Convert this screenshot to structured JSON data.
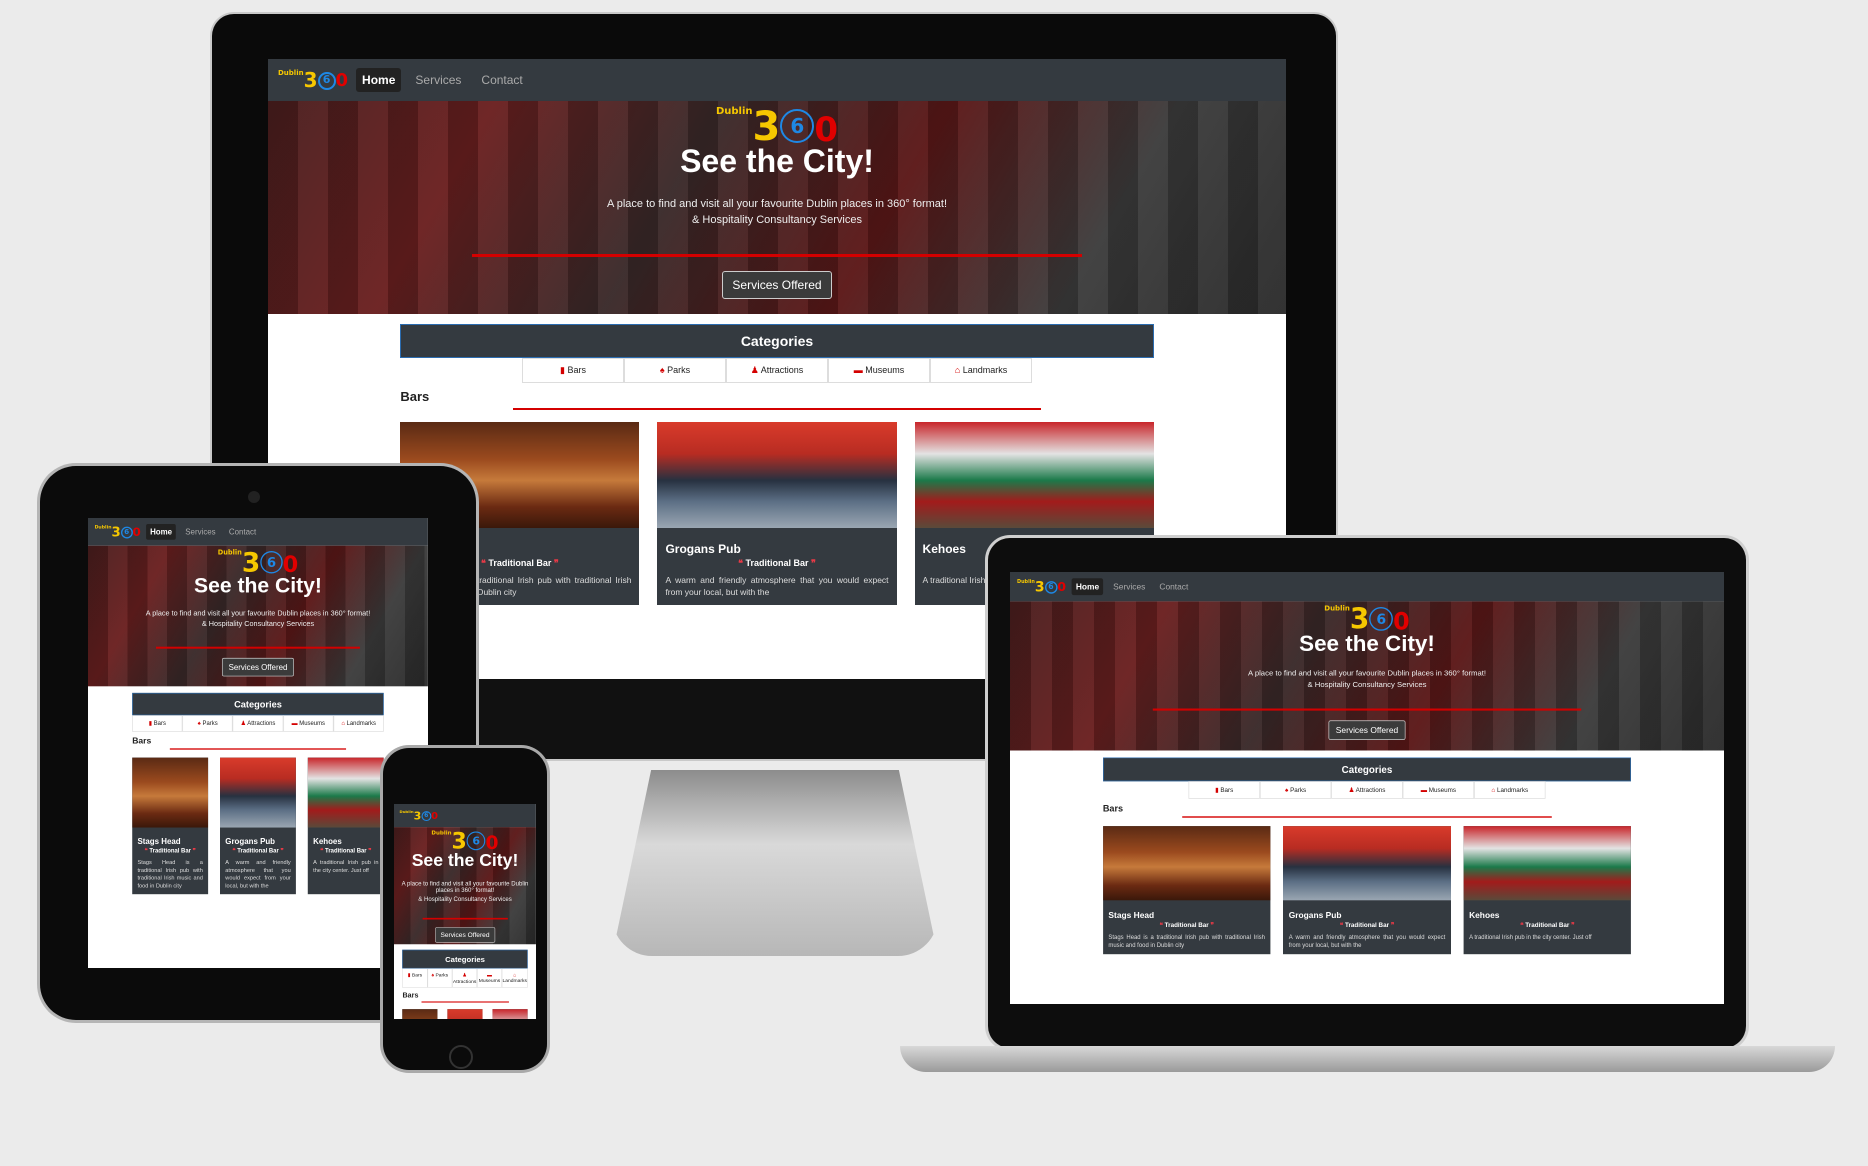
{
  "site": {
    "logo": {
      "small": "Dublin",
      "d3": "3",
      "d6": "6",
      "d0": "0"
    },
    "nav": [
      {
        "label": "Home",
        "active": true
      },
      {
        "label": "Services",
        "active": false
      },
      {
        "label": "Contact",
        "active": false
      }
    ],
    "hero": {
      "title": "See the City!",
      "line1": "A place to find and visit all your favourite Dublin places in 360° format!",
      "line2": "& Hospitality Consultancy Services",
      "button": "Services Offered"
    },
    "categories": {
      "title": "Categories",
      "tabs": [
        {
          "label": "Bars",
          "icon": "beer-icon"
        },
        {
          "label": "Parks",
          "icon": "tree-icon"
        },
        {
          "label": "Attractions",
          "icon": "person-icon"
        },
        {
          "label": "Museums",
          "icon": "ticket-icon"
        },
        {
          "label": "Landmarks",
          "icon": "monument-icon"
        }
      ]
    },
    "section": "Bars",
    "cards": [
      {
        "title": "Stags Head",
        "subtitle": "Traditional Bar",
        "text": "Stags Head is a traditional Irish pub with traditional Irish music and food in Dublin city"
      },
      {
        "title": "Grogans Pub",
        "subtitle": "Traditional Bar",
        "text": "A warm and friendly atmosphere that you would expect from your local, but with the"
      },
      {
        "title": "Kehoes",
        "subtitle": "Traditional Bar",
        "text": "A traditional Irish pub in the city center. Just off"
      }
    ]
  },
  "colors": {
    "brand_red": "#d40000",
    "nav_dark": "#343a40",
    "logo_yellow": "#f6c700",
    "logo_blue": "#1e88e5"
  }
}
